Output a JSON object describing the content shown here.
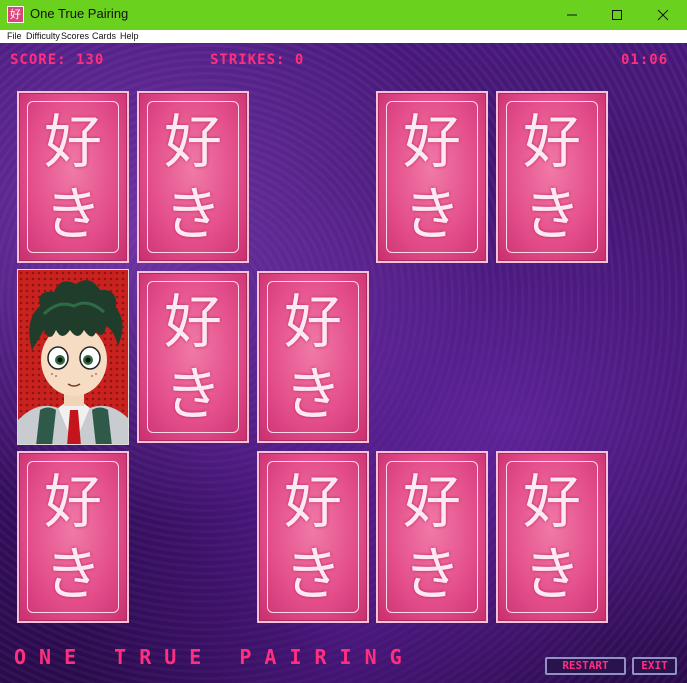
{
  "window": {
    "title": "One True Pairing",
    "app_icon": "好"
  },
  "menu": [
    "File",
    "Difficulty",
    "Scores",
    "Cards",
    "Help"
  ],
  "hud": {
    "score": "SCORE: 130",
    "strikes": "STRIKES: 0",
    "timer": "01:06"
  },
  "card_back": {
    "glyph_top": "好",
    "glyph_bottom": "き"
  },
  "footer": {
    "title": "ONE TRUE PAIRING",
    "restart_label": "RESTART",
    "exit_label": "EXIT"
  },
  "colors": {
    "accent": "#ff2f7d",
    "titlebar": "#6bd11f",
    "card": "#e44f8b"
  }
}
